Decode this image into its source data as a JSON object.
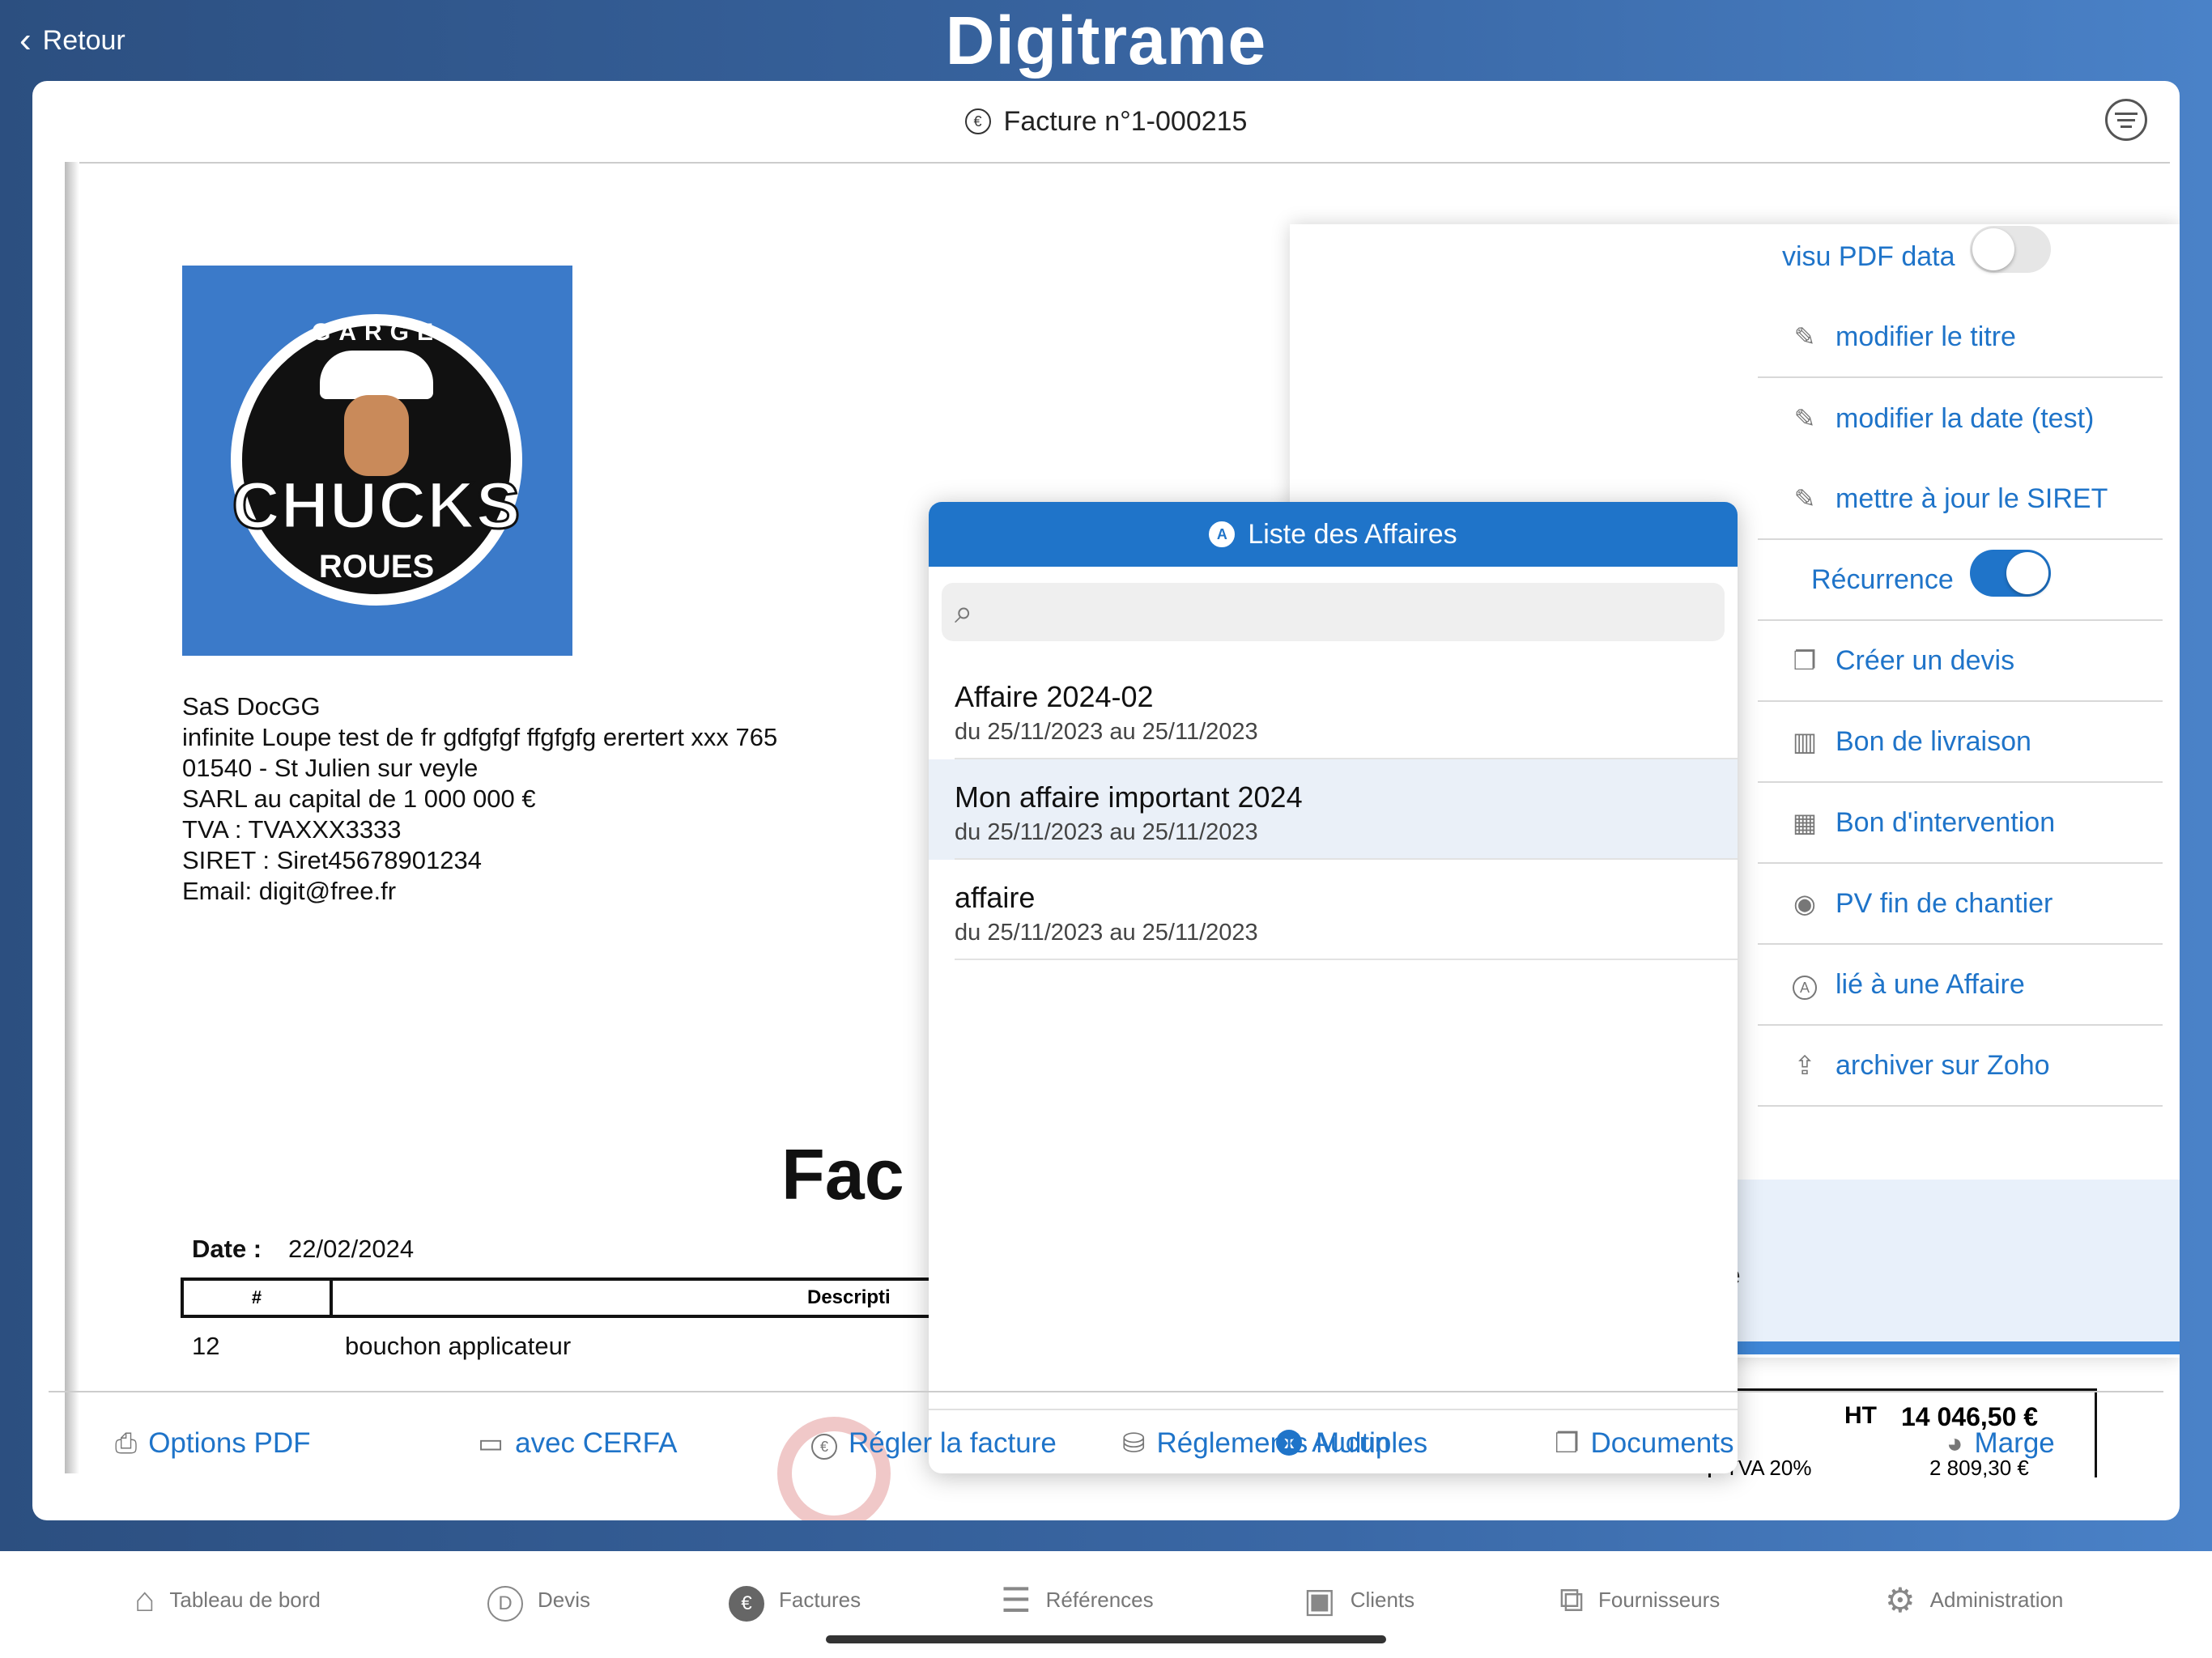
{
  "header": {
    "back_label": "Retour",
    "logo": "Digitrame"
  },
  "card": {
    "title": "Facture n°1-000215",
    "title_icon": "euro-circle-icon"
  },
  "pdf": {
    "logo_text": {
      "top": "GARGE",
      "main": "CHUCKS",
      "sub": "ROUES"
    },
    "company_lines": [
      "SaS DocGG",
      "infinite Loupe test de fr gdfgfgf ffgfgfg erertert xxx 765",
      "01540 - St Julien sur veyle",
      "SARL au capital de 1 000 000 €",
      "TVA : TVAXXX3333",
      "SIRET : Siret45678901234",
      "Email: digit@free.fr"
    ],
    "doc_title_partial": "Fac",
    "date_label": "Date :",
    "date_value": "22/02/2024",
    "table_header": {
      "num": "#",
      "description": "Descripti"
    },
    "rows": [
      {
        "num": "12",
        "description": "bouchon applicateur"
      }
    ],
    "totals": {
      "ht_label": "HT",
      "ht_value": "14 046,50 €",
      "tva_label": "TVA 20%",
      "tva_value": "2 809,30 €"
    }
  },
  "menu": {
    "items": [
      {
        "label": "visu PDF data",
        "type": "toggle",
        "on": false
      },
      {
        "label": "modifier le titre",
        "icon": "pencil-icon"
      },
      {
        "label": "modifier la date (test)",
        "icon": "pencil-icon"
      },
      {
        "label": "mettre à jour le SIRET",
        "icon": "pencil-icon"
      },
      {
        "label": "Récurrence",
        "type": "toggle",
        "on": true
      },
      {
        "label": "Créer un devis",
        "icon": "document-copy-icon"
      },
      {
        "label": "Bon de livraison",
        "icon": "map-icon"
      },
      {
        "label": "Bon d'intervention",
        "icon": "calendar-icon"
      },
      {
        "label": "PV fin de chantier",
        "icon": "circle-doc-icon"
      },
      {
        "label": "lié à une Affaire",
        "icon": "a-circle-icon"
      },
      {
        "label": "archiver sur Zoho",
        "icon": "upload-icon"
      }
    ],
    "bottom_text": "te",
    "toggle_color": "#1f74c9"
  },
  "popover": {
    "title": "Liste des Affaires",
    "search_placeholder": "",
    "items": [
      {
        "title": "Affaire 2024-02",
        "dates": "du 25/11/2023 au 25/11/2023",
        "selected": false
      },
      {
        "title": "Mon affaire important 2024",
        "dates": "du 25/11/2023 au 25/11/2023",
        "selected": true
      },
      {
        "title": "affaire",
        "dates": "du 25/11/2023 au 25/11/2023",
        "selected": false
      }
    ],
    "footer_label": "Aucun"
  },
  "actions": [
    {
      "label": "Options PDF",
      "icon": "inbox-icon"
    },
    {
      "label": "avec CERFA",
      "icon": "card-icon"
    },
    {
      "label": "Régler la facture",
      "icon": "euro-circle-icon"
    },
    {
      "label": "Réglements Multiples",
      "icon": "coins-icon"
    },
    {
      "label": "Documents",
      "icon": "documents-icon"
    },
    {
      "label": "Marge",
      "icon": "pie-icon"
    }
  ],
  "tabs": [
    {
      "label": "Tableau de bord",
      "icon": "home-icon"
    },
    {
      "label": "Devis",
      "icon": "d-circle-icon"
    },
    {
      "label": "Factures",
      "icon": "euro-circle-icon",
      "active": true
    },
    {
      "label": "Références",
      "icon": "list-icon"
    },
    {
      "label": "Clients",
      "icon": "person-icon"
    },
    {
      "label": "Fournisseurs",
      "icon": "supplier-icon"
    },
    {
      "label": "Administration",
      "icon": "sliders-icon"
    }
  ],
  "colors": {
    "accent": "#1f74c9",
    "brand_bg": "#3a68a6",
    "selected_row": "#eaf0f8"
  }
}
